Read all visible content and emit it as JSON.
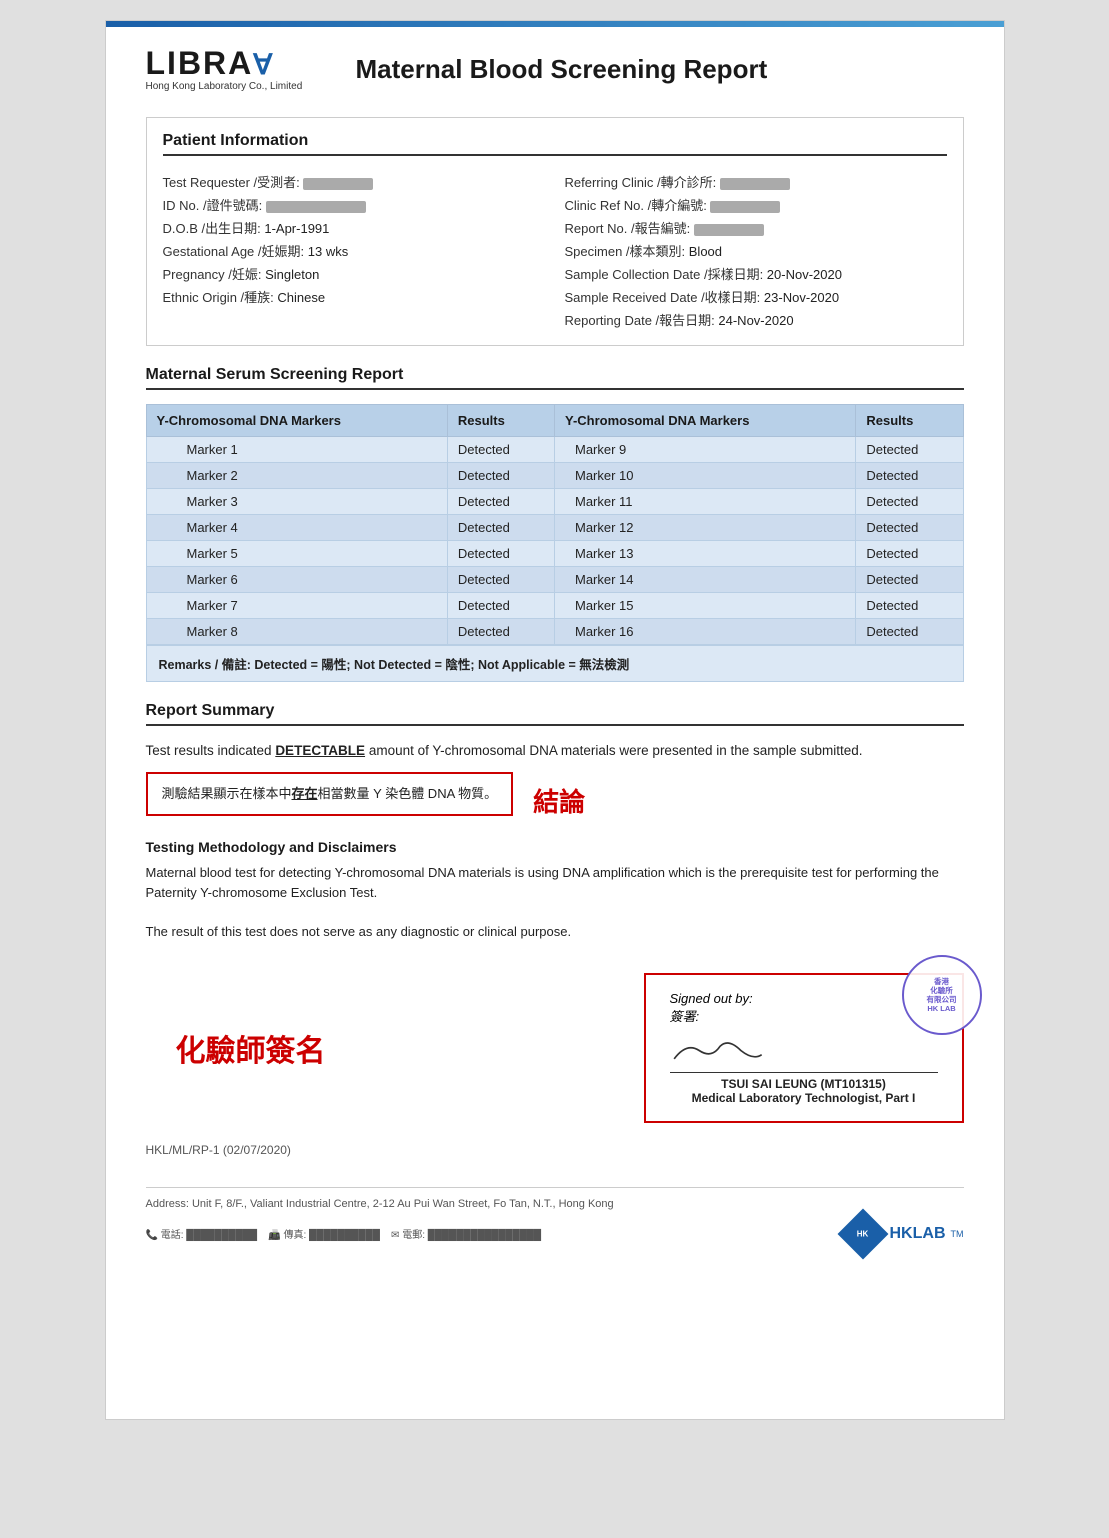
{
  "topBar": {},
  "header": {
    "logoMain": "LIBRA",
    "logoSub": "Hong Kong Laboratory Co., Limited",
    "reportTitle": "Maternal Blood Screening Report"
  },
  "patientInfo": {
    "sectionTitle": "Patient Information",
    "leftFields": [
      {
        "label": "Test Requester /受測者:",
        "value": "redacted"
      },
      {
        "label": "ID No. /證件號碼:",
        "value": "redacted"
      },
      {
        "label": "D.O.B /出生日期:",
        "value": "1-Apr-1991"
      },
      {
        "label": "Gestational Age /妊娠期:",
        "value": "13 wks"
      },
      {
        "label": "Pregnancy /妊娠:",
        "value": "Singleton"
      },
      {
        "label": "Ethnic Origin /種族:",
        "value": "Chinese"
      }
    ],
    "rightFields": [
      {
        "label": "Referring Clinic /轉介診所:",
        "value": "redacted"
      },
      {
        "label": "Clinic Ref No. /轉介編號:",
        "value": "redacted"
      },
      {
        "label": "Report No. /報告編號:",
        "value": "redacted"
      },
      {
        "label": "Specimen /樣本類別:",
        "value": "Blood"
      },
      {
        "label": "Sample Collection Date /採樣日期:",
        "value": "20-Nov-2020"
      },
      {
        "label": "Sample Received Date /收樣日期:",
        "value": "23-Nov-2020"
      },
      {
        "label": "Reporting Date /報告日期:",
        "value": "24-Nov-2020"
      }
    ]
  },
  "serumReport": {
    "sectionTitle": "Maternal Serum Screening Report",
    "col1Header": "Y-Chromosomal DNA Markers",
    "col2Header": "Results",
    "col3Header": "Y-Chromosomal DNA Markers",
    "col4Header": "Results",
    "leftMarkers": [
      {
        "marker": "Marker 1",
        "result": "Detected"
      },
      {
        "marker": "Marker 2",
        "result": "Detected"
      },
      {
        "marker": "Marker 3",
        "result": "Detected"
      },
      {
        "marker": "Marker 4",
        "result": "Detected"
      },
      {
        "marker": "Marker 5",
        "result": "Detected"
      },
      {
        "marker": "Marker 6",
        "result": "Detected"
      },
      {
        "marker": "Marker 7",
        "result": "Detected"
      },
      {
        "marker": "Marker 8",
        "result": "Detected"
      }
    ],
    "rightMarkers": [
      {
        "marker": "Marker 9",
        "result": "Detected"
      },
      {
        "marker": "Marker 10",
        "result": "Detected"
      },
      {
        "marker": "Marker 11",
        "result": "Detected"
      },
      {
        "marker": "Marker 12",
        "result": "Detected"
      },
      {
        "marker": "Marker 13",
        "result": "Detected"
      },
      {
        "marker": "Marker 14",
        "result": "Detected"
      },
      {
        "marker": "Marker 15",
        "result": "Detected"
      },
      {
        "marker": "Marker 16",
        "result": "Detected"
      }
    ],
    "remarks": "Remarks / 備註: Detected = 陽性; Not Detected = 陰性; Not Applicable = 無法檢測"
  },
  "reportSummary": {
    "sectionTitle": "Report Summary",
    "summaryText1": "Test results indicated ",
    "detectableWord": "DETECTABLE",
    "summaryText2": " amount of Y-chromosomal DNA materials were presented in the sample submitted.",
    "chineseText": "測驗結果顯示在樣本中",
    "chineseBold": "存在",
    "chineseText2": "相當數量 Y 染色體 DNA 物質。",
    "conclusionLabel": "結論"
  },
  "methodology": {
    "title": "Testing Methodology and Disclaimers",
    "text1": "Maternal blood test for detecting Y-chromosomal DNA materials is using DNA amplification which is the prerequisite test for performing the Paternity Y-chromosome Exclusion Test.",
    "text2": "The result of this test does not serve as any diagnostic or clinical purpose."
  },
  "signature": {
    "chemistLabel": "化驗師簽名",
    "signedOutBy": "Signed out by:",
    "signedChinese": "簽署:",
    "signerName": "TSUI SAI LEUNG (MT101315)",
    "signerTitle": "Medical Laboratory Technologist, Part I",
    "stampText": "香港\n化驗所\n有限公司\nHong Kong\nLaboratory Co.\nLimited"
  },
  "footer": {
    "ref": "HKL/ML/RP-1 (02/07/2020)",
    "address": "Address: Unit F, 8/F., Valiant Industrial Centre, 2-12 Au Pui Wan Street, Fo Tan, N.T., Hong Kong",
    "contacts": "電話: (redacted)   傳真: (redacted)   電郵: (redacted)",
    "hklabText": "HKLAB"
  }
}
